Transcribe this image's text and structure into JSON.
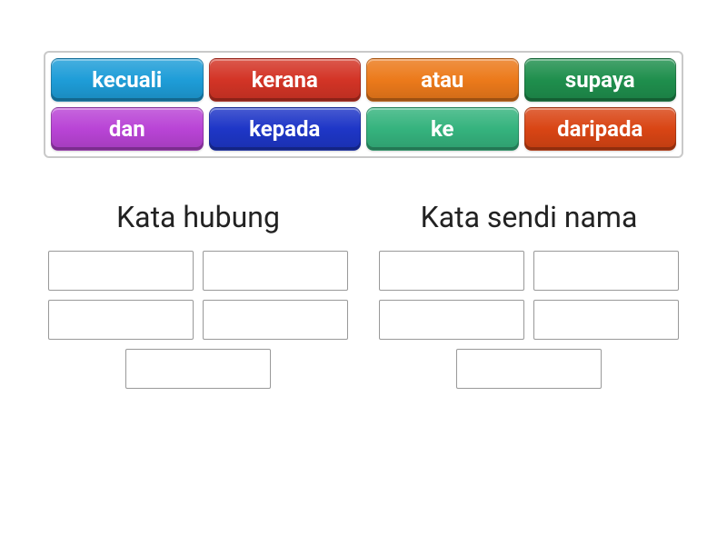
{
  "word_bank": {
    "tiles": [
      {
        "label": "kecuali",
        "color": "#1E9DD8"
      },
      {
        "label": "kerana",
        "color": "#D33426"
      },
      {
        "label": "atau",
        "color": "#EC7A1B"
      },
      {
        "label": "supaya",
        "color": "#1F8F4D"
      },
      {
        "label": "dan",
        "color": "#B944D6"
      },
      {
        "label": "kepada",
        "color": "#1E36C7"
      },
      {
        "label": "ke",
        "color": "#35B37E"
      },
      {
        "label": "daripada",
        "color": "#D94514"
      }
    ]
  },
  "categories": [
    {
      "title": "Kata hubung",
      "slot_count": 5
    },
    {
      "title": "Kata sendi nama",
      "slot_count": 5
    }
  ]
}
